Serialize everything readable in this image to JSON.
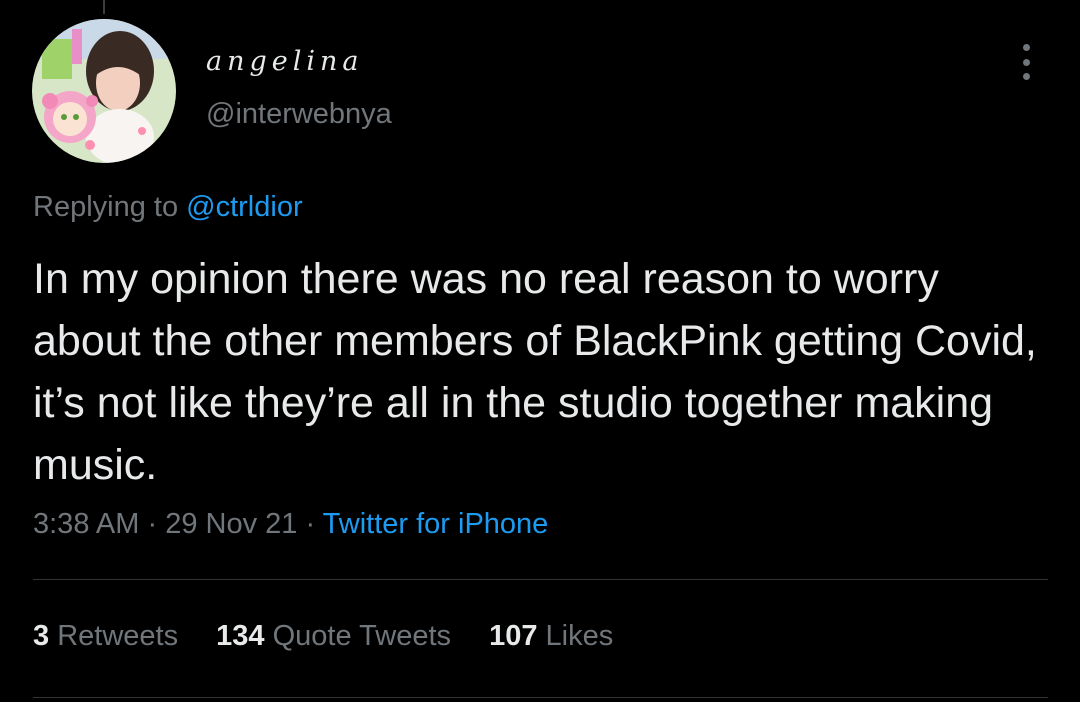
{
  "user": {
    "display_name": "angelina",
    "handle": "@interwebnya"
  },
  "reply": {
    "prefix": "Replying to",
    "mention": "@ctrldior"
  },
  "tweet": {
    "text": "In my opinion there was no real reason to worry about the other members of BlackPink getting Covid, it’s not like they’re all in the studio together making music."
  },
  "meta": {
    "time": "3:38 AM",
    "separator": " · ",
    "date": "29 Nov 21",
    "source": "Twitter for iPhone"
  },
  "stats": [
    {
      "count": "3",
      "label": "Retweets"
    },
    {
      "count": "134",
      "label": "Quote Tweets"
    },
    {
      "count": "107",
      "label": "Likes"
    }
  ],
  "colors": {
    "background": "#000000",
    "text": "#e7e9ea",
    "secondary_text": "#71767b",
    "link": "#1d9bf0",
    "divider": "#2f3336"
  },
  "icons": {
    "more": "more-vertical-icon"
  }
}
